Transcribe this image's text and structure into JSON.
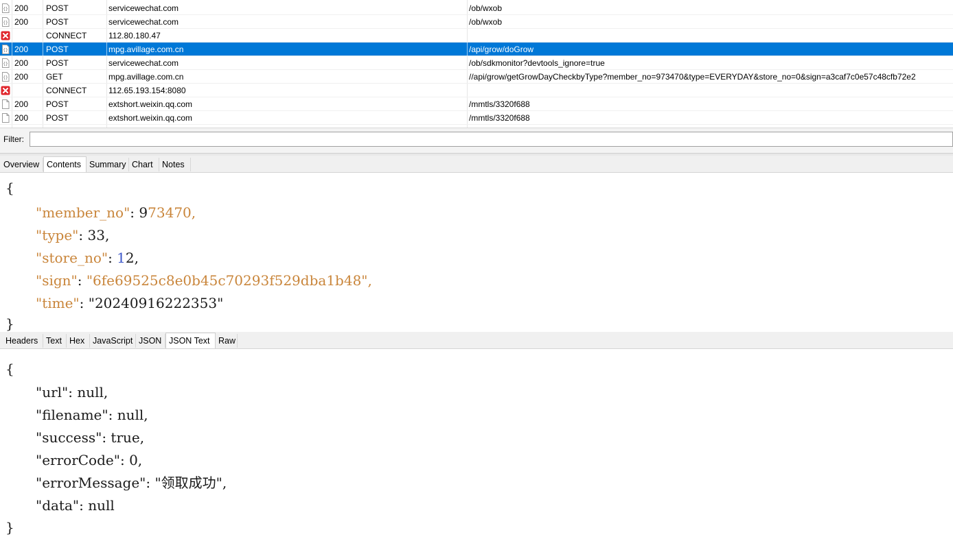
{
  "requests": [
    {
      "status": "200",
      "method": "POST",
      "host": "servicewechat.com",
      "url": "/ob/wxob",
      "icon": "json-doc-icon",
      "selected": false
    },
    {
      "status": "200",
      "method": "POST",
      "host": "servicewechat.com",
      "url": "/ob/wxob",
      "icon": "json-doc-icon",
      "selected": false
    },
    {
      "status": "",
      "method": "CONNECT",
      "host": "112.80.180.47",
      "url": "",
      "icon": "error-icon",
      "selected": false
    },
    {
      "status": "200",
      "method": "POST",
      "host": "mpg.avillage.com.cn",
      "url": "/api/grow/doGrow",
      "icon": "json-doc-icon",
      "selected": true
    },
    {
      "status": "200",
      "method": "POST",
      "host": "servicewechat.com",
      "url": "/ob/sdkmonitor?devtools_ignore=true",
      "icon": "json-doc-icon",
      "selected": false
    },
    {
      "status": "200",
      "method": "GET",
      "host": "mpg.avillage.com.cn",
      "url": "//api/grow/getGrowDayCheckbyType?member_no=973470&type=EVERYDAY&store_no=0&sign=a3caf7c0e57c48cfb72e2",
      "icon": "json-doc-icon",
      "selected": false
    },
    {
      "status": "",
      "method": "CONNECT",
      "host": "112.65.193.154:8080",
      "url": "",
      "icon": "error-icon",
      "selected": false
    },
    {
      "status": "200",
      "method": "POST",
      "host": "extshort.weixin.qq.com",
      "url": "/mmtls/3320f688",
      "icon": "doc-icon",
      "selected": false
    },
    {
      "status": "200",
      "method": "POST",
      "host": "extshort.weixin.qq.com",
      "url": "/mmtls/3320f688",
      "icon": "doc-icon",
      "selected": false
    }
  ],
  "filter": {
    "label": "Filter:",
    "value": "",
    "placeholder": ""
  },
  "request_tabs": [
    "Overview",
    "Contents",
    "Summary",
    "Chart",
    "Notes"
  ],
  "request_tabs_active": "Contents",
  "request_body": {
    "open": "{",
    "close": "}",
    "lines": [
      {
        "key": "\"member_no\"",
        "sep": ": ",
        "value_a": "9",
        "value_b": "73470",
        "end": ","
      },
      {
        "key": "\"type\"",
        "sep": ": ",
        "value": "33",
        "end": ","
      },
      {
        "key": "\"store_no\"",
        "sep": ": ",
        "value_a": "1",
        "value_b": "2",
        "end": ","
      },
      {
        "key": "\"sign\"",
        "sep": ": ",
        "value": "\"6fe69525c8e0b45c70293f529dba1b48\"",
        "end": ","
      },
      {
        "key": "\"time\"",
        "sep": ": ",
        "value": "\"20240916222353\"",
        "end": ""
      }
    ]
  },
  "response_tabs": [
    "Headers",
    "Text",
    "Hex",
    "JavaScript",
    "JSON",
    "JSON Text",
    "Raw"
  ],
  "response_tabs_active": "JSON Text",
  "response_body": {
    "open": "{",
    "close": "}",
    "lines": [
      {
        "key": "\"url\"",
        "sep": ": ",
        "value": "null",
        "end": ","
      },
      {
        "key": "\"filename\"",
        "sep": ": ",
        "value": "null",
        "end": ","
      },
      {
        "key": "\"success\"",
        "sep": ": ",
        "value": "true",
        "end": ","
      },
      {
        "key": "\"errorCode\"",
        "sep": ": ",
        "value": "0",
        "end": ","
      },
      {
        "key": "\"errorMessage\"",
        "sep": ": ",
        "value": "\"领取成功\"",
        "end": ","
      },
      {
        "key": "\"data\"",
        "sep": ": ",
        "value": "null",
        "end": ""
      }
    ]
  },
  "colors": {
    "selection": "#0078d7",
    "json_key": "#c9853a",
    "json_number_blue": "#3a55c8",
    "error_icon": "#e0272e"
  }
}
